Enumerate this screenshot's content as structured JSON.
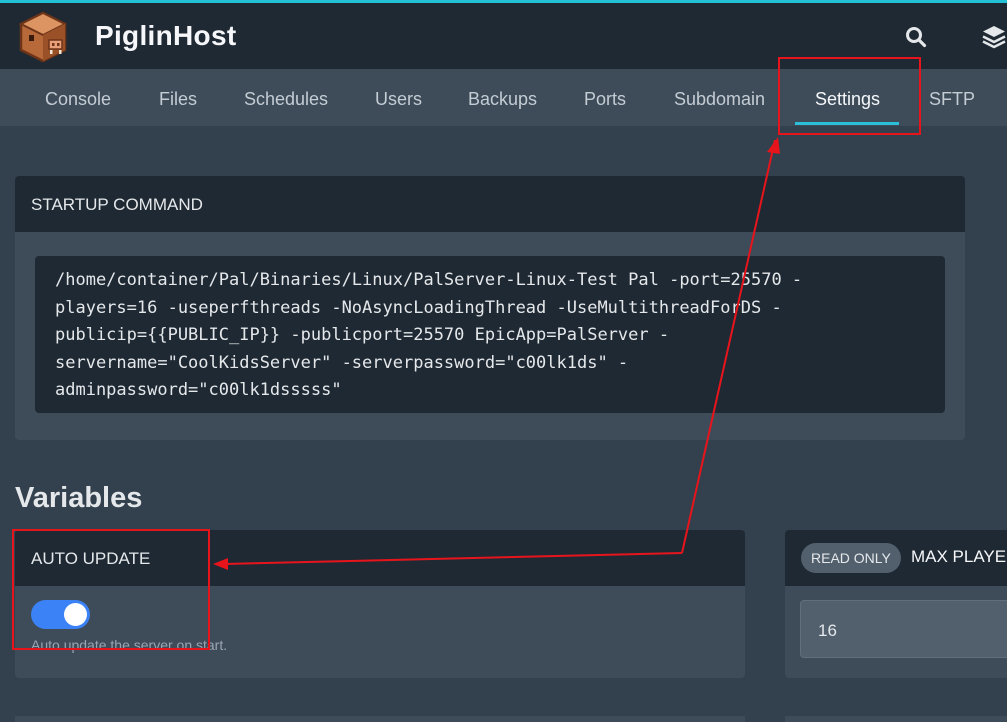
{
  "brand": {
    "name": "PiglinHost"
  },
  "header_icons": [
    "search-icon",
    "layers-icon"
  ],
  "nav": {
    "tabs": [
      "Console",
      "Files",
      "Schedules",
      "Users",
      "Backups",
      "Ports",
      "Subdomain",
      "Settings",
      "SFTP"
    ],
    "active": "Settings"
  },
  "startup": {
    "title": "STARTUP COMMAND",
    "command_lines": [
      "/home/container/Pal/Binaries/Linux/PalServer-Linux-Test Pal -port=25570 -",
      "players=16 -useperfthreads -NoAsyncLoadingThread -UseMultithreadForDS -",
      "publicip={{PUBLIC_IP}} -publicport=25570 EpicApp=PalServer -",
      "servername=\"CoolKidsServer\" -serverpassword=\"c00lk1ds\" -",
      "adminpassword=\"c00lk1dsssss\""
    ]
  },
  "variables": {
    "title": "Variables",
    "auto_update": {
      "title": "AUTO UPDATE",
      "enabled": true,
      "description": "Auto update the server on start."
    },
    "max_players": {
      "badge": "READ ONLY",
      "title": "MAX PLAYERS",
      "value": "16"
    }
  },
  "colors": {
    "accent": "#2cc0d8",
    "toggle_on": "#3b82f6",
    "annotation": "#e8141c",
    "header_bg": "#1f2933",
    "panel_bg": "#3e4c59",
    "page_bg": "#33404d"
  }
}
